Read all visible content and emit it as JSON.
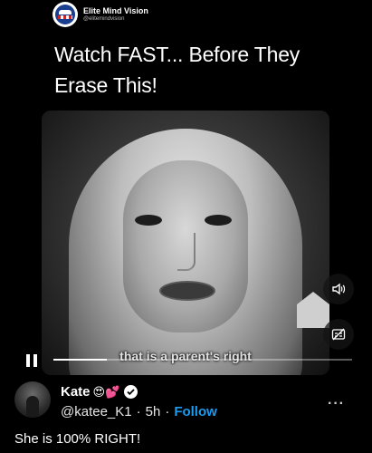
{
  "source": {
    "name": "Elite Mind Vision",
    "handle": "@elitemindvision"
  },
  "headline": "Watch FAST... Before They Erase This!",
  "video": {
    "caption": "that is a parent's right",
    "progress_fraction": 0.18
  },
  "reply": {
    "name": "Kate",
    "emojis": "😍💕",
    "handle": "@katee_K1",
    "time": "5h",
    "follow_label": "Follow",
    "more": "···",
    "text": "She is 100% RIGHT!"
  }
}
